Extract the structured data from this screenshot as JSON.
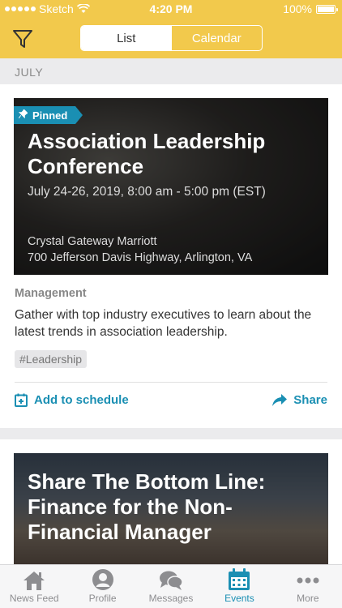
{
  "status_bar": {
    "carrier": "Sketch",
    "time": "4:20 PM",
    "battery": "100%"
  },
  "header": {
    "filter_icon": "filter-icon",
    "segments": [
      {
        "label": "List",
        "active": true
      },
      {
        "label": "Calendar",
        "active": false
      }
    ]
  },
  "month_label": "JULY",
  "events": [
    {
      "pinned_label": "Pinned",
      "title": "Association Leadership Conference",
      "date": "July 24-26, 2019, 8:00 am - 5:00 pm (EST)",
      "venue": "Crystal Gateway Marriott",
      "address": "700 Jefferson Davis Highway, Arlington, VA",
      "category": "Management",
      "description": "Gather with top industry executives to learn about the latest trends in association leadership.",
      "tag": "#Leadership",
      "add_label": "Add to schedule",
      "share_label": "Share"
    },
    {
      "title": "Share The Bottom Line: Finance for the Non-Financial Manager"
    }
  ],
  "tabs": [
    {
      "label": "News Feed",
      "icon": "home-icon"
    },
    {
      "label": "Profile",
      "icon": "profile-icon"
    },
    {
      "label": "Messages",
      "icon": "messages-icon"
    },
    {
      "label": "Events",
      "icon": "calendar-icon",
      "active": true
    },
    {
      "label": "More",
      "icon": "more-icon"
    }
  ],
  "colors": {
    "header": "#f2c94c",
    "accent": "#1a8fb3"
  }
}
